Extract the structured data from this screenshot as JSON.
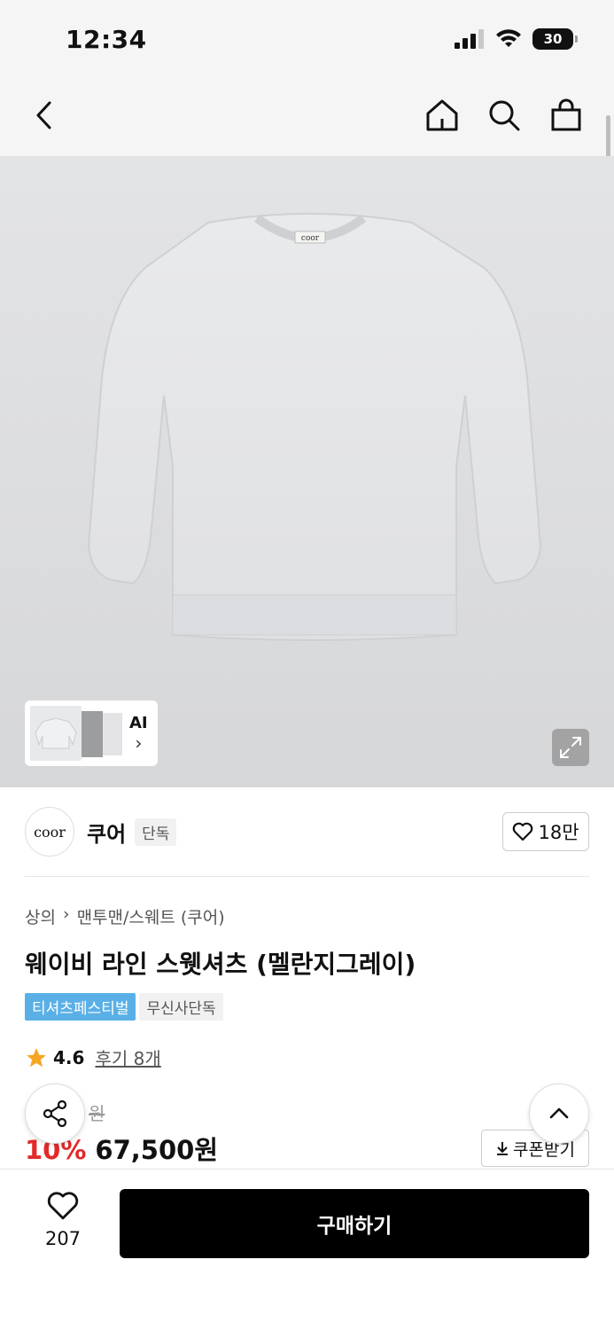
{
  "status_bar": {
    "time": "12:34",
    "battery": "30"
  },
  "product": {
    "image_label": "coor",
    "thumbnail_ai_label": "AI",
    "brand": {
      "logo_text": "coor",
      "name": "쿠어",
      "tag": "단독",
      "likes": "18만"
    },
    "breadcrumb": {
      "category": "상의",
      "sub_category": "맨투맨/스웨트 (쿠어)"
    },
    "title": "웨이비 라인 스웻셔츠 (멜란지그레이)",
    "badges": {
      "festival": "티셔츠페스티벌",
      "exclusive": "무신사단독"
    },
    "rating": {
      "score": "4.6",
      "review_text": "후기 8개"
    },
    "price": {
      "original": "원",
      "discount": "10%",
      "sale": "67,500원"
    },
    "coupon_label": "쿠폰받기"
  },
  "bottom_bar": {
    "like_count": "207",
    "buy_label": "구매하기"
  },
  "colors": {
    "discount": "#e32929",
    "festival_badge": "#5ab0e6",
    "buy_button": "#000000",
    "star": "#f5a623"
  }
}
